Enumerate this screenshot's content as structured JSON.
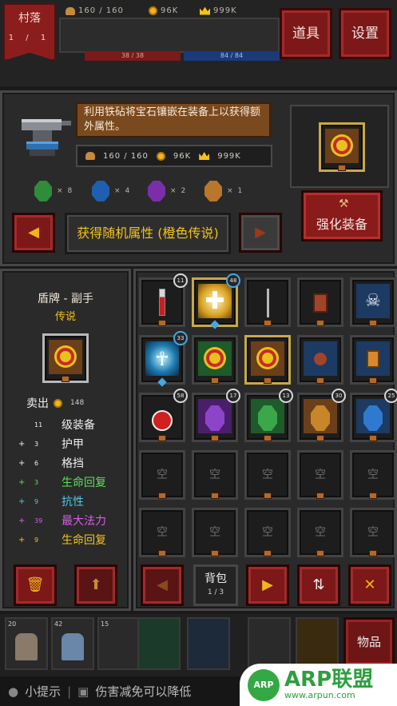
{
  "topbar": {
    "village_label": "村落",
    "village_page": "1 / 1",
    "food": "160 / 160",
    "gold": "96K",
    "crowns": "999K",
    "hp": "38 / 38",
    "mp": "84 / 84",
    "props_label": "道具",
    "settings_label": "设置"
  },
  "enchant": {
    "tip": "利用铁砧将宝石镶嵌在装备上以获得额外属性。",
    "cost_food": "160 / 160",
    "cost_gold": "96K",
    "cost_crowns": "999K",
    "gems": [
      {
        "color": "#2f8c3a",
        "count": "8"
      },
      {
        "color": "#1f5fb0",
        "count": "4"
      },
      {
        "color": "#7a2fa8",
        "count": "2"
      },
      {
        "color": "#b8772a",
        "count": "1"
      }
    ],
    "prev_icon": "triangle-left-icon",
    "next_icon": "triangle-right-icon",
    "mode_label": "获得随机属性 (橙色传说)",
    "enhance_label": "强化装备"
  },
  "detail": {
    "name": "盾牌 - 副手",
    "rarity": "传说",
    "sell_label": "卖出",
    "sell_value": "148",
    "stats": [
      {
        "sign": "",
        "num": "11",
        "label": "级装备",
        "color": "#eeeeee"
      },
      {
        "sign": "+",
        "num": "3",
        "label": "护甲",
        "color": "#eeeeee"
      },
      {
        "sign": "+",
        "num": "6",
        "label": "格挡",
        "color": "#eeeeee"
      },
      {
        "sign": "+",
        "num": "3",
        "label": "生命回复",
        "color": "#5ee05e"
      },
      {
        "sign": "+",
        "num": "9",
        "label": "抗性",
        "color": "#4ec8e8"
      },
      {
        "sign": "+",
        "num": "39",
        "label": "最大法力",
        "color": "#d65ee8"
      },
      {
        "sign": "+",
        "num": "9",
        "label": "生命回复",
        "color": "#f2c31c"
      }
    ],
    "trash_icon": "trash-icon",
    "upgrade_icon": "arrow-up-icon"
  },
  "inventory": {
    "bag_label": "背包",
    "page": "1 / 3",
    "empty_label": "空",
    "slots": [
      {
        "kind": "potion-tube-icon",
        "level": "11"
      },
      {
        "kind": "holy-light-icon",
        "level": "48"
      },
      {
        "kind": "sword-icon",
        "level": ""
      },
      {
        "kind": "spellbook-icon",
        "level": ""
      },
      {
        "kind": "skull-icon",
        "level": ""
      },
      {
        "kind": "summon-rune-icon",
        "level": "33"
      },
      {
        "kind": "shield-target-icon",
        "level": ""
      },
      {
        "kind": "shield-target-icon",
        "level": ""
      },
      {
        "kind": "pouch-icon",
        "level": ""
      },
      {
        "kind": "scroll-icon",
        "level": ""
      },
      {
        "kind": "red-potion-icon",
        "level": "58"
      },
      {
        "kind": "purple-gem-icon",
        "level": "17"
      },
      {
        "kind": "green-gem-icon",
        "level": "13"
      },
      {
        "kind": "orange-gem-icon",
        "level": "30"
      },
      {
        "kind": "blue-gem-icon",
        "level": "25"
      }
    ],
    "prev_icon": "triangle-left-icon",
    "next_icon": "triangle-right-icon",
    "sort_icon": "sort-icon",
    "close_icon": "close-icon"
  },
  "bottom": {
    "items_label": "物品",
    "hint_label": "小提示",
    "hint_text": "伤害减免可以降低",
    "hero_levels": [
      "20",
      "42",
      "15"
    ]
  },
  "watermark": {
    "logo": "ARP",
    "brand": "ARP联盟",
    "url": "www.arpun.com"
  }
}
